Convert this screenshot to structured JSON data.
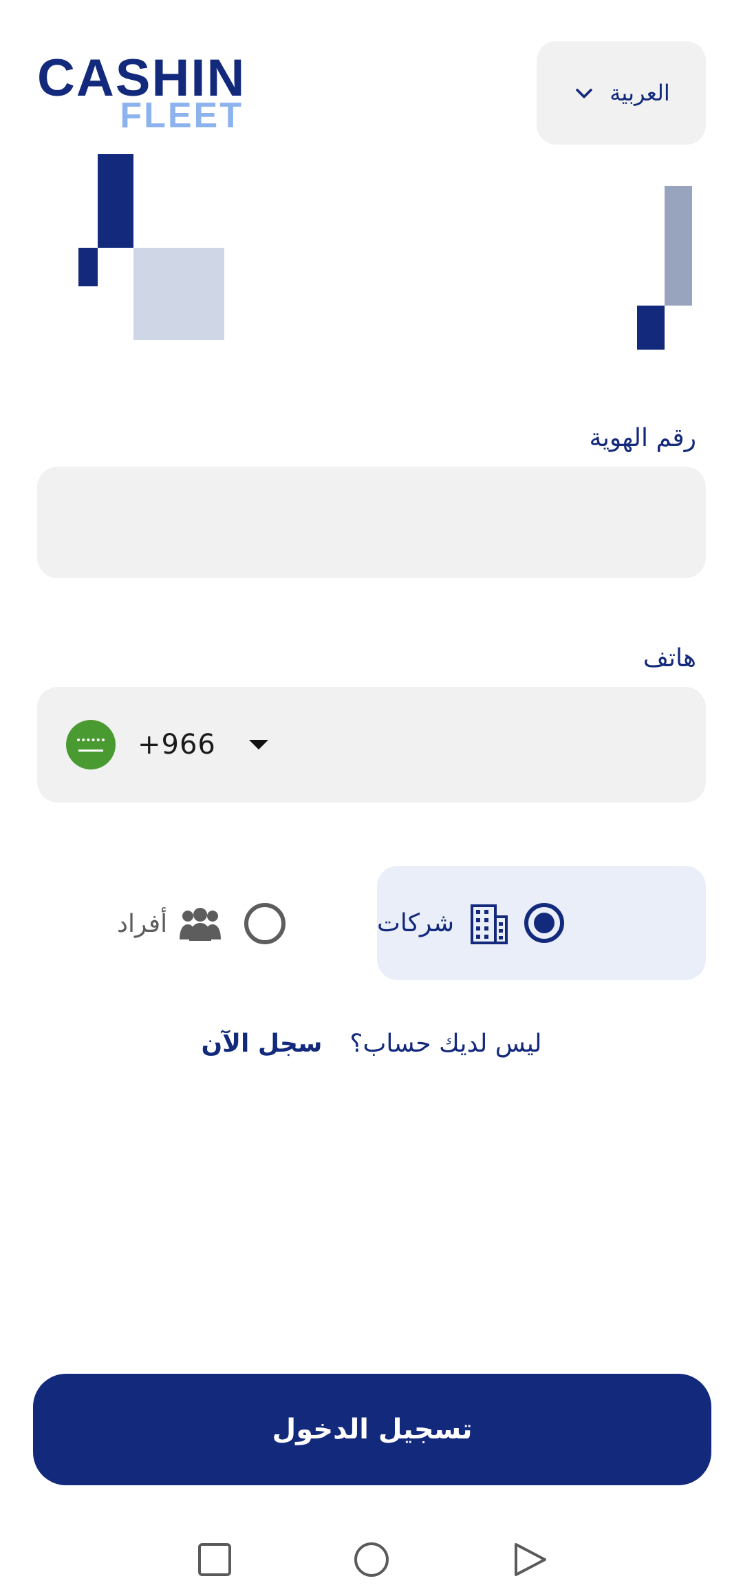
{
  "brand": {
    "logo_top": "CASHIN",
    "logo_bottom": "FLEET"
  },
  "language": {
    "selected": "العربية",
    "icon": "chevron-down-icon"
  },
  "form": {
    "id_label": "رقم الهوية",
    "id_value": "",
    "phone_label": "هاتف",
    "dial_code": "+966",
    "country_flag": "saudi-arabia-flag-icon",
    "phone_value": ""
  },
  "account_type": {
    "companies_label": "شركات",
    "companies_icon": "building-icon",
    "individuals_label": "أفراد",
    "individuals_icon": "people-group-icon",
    "selected": "companies"
  },
  "register": {
    "question": "ليس لديك حساب؟",
    "link": "سجل الآن"
  },
  "login_button": "تسجيل الدخول",
  "colors": {
    "primary": "#13297c",
    "accent_light": "#8db3ef",
    "field_bg": "#f1f1f1",
    "card_selected_bg": "#e9eef8"
  },
  "navbar": {
    "icons": [
      "recent-apps-icon",
      "home-icon",
      "back-icon"
    ]
  }
}
